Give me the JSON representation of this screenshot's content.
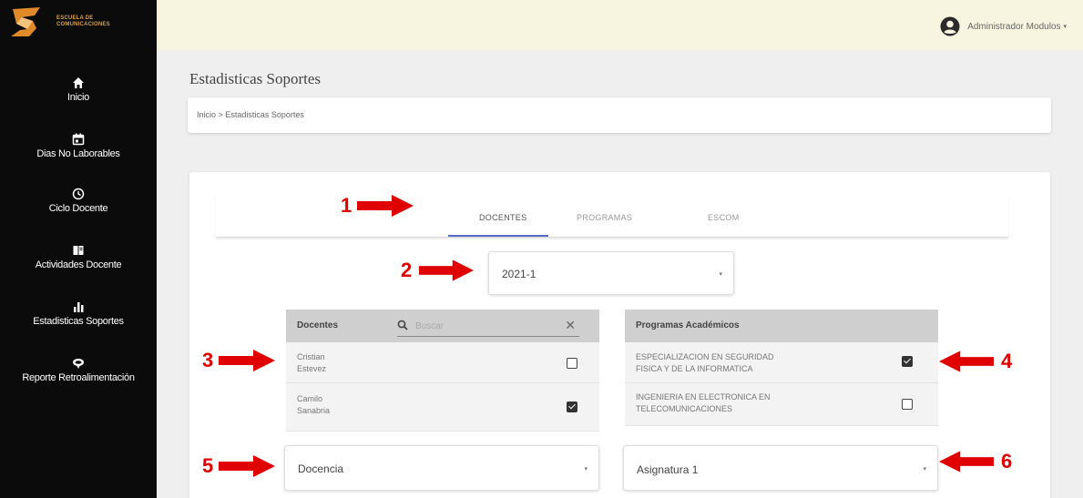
{
  "logo": {
    "name": "logo-escuela",
    "text_line1": "ESCUELA DE",
    "text_line2": "COMUNICACIONES"
  },
  "sidebar": {
    "items": [
      {
        "label": "Inicio",
        "icon": "home-icon"
      },
      {
        "label": "Dias No Laborables",
        "icon": "calendar-icon"
      },
      {
        "label": "Ciclo Docente",
        "icon": "clock-icon"
      },
      {
        "label": "Actividades Docente",
        "icon": "book-icon"
      },
      {
        "label": "Estadisticas Soportes",
        "icon": "bar-chart-icon"
      },
      {
        "label": "Reporte Retroalimentación",
        "icon": "feedback-icon"
      }
    ]
  },
  "header": {
    "user_name": "Administrador Modulos",
    "user_caret": "▾"
  },
  "page": {
    "title": "Estadisticas Soportes",
    "breadcrumb": {
      "home": "Inicio",
      "separator": ">",
      "current": "Estadisticas Soportes"
    }
  },
  "tabs": [
    {
      "label": "DOCENTES",
      "active": true
    },
    {
      "label": "PROGRAMAS",
      "active": false
    },
    {
      "label": "ESCOM",
      "active": false
    }
  ],
  "period_select": {
    "value": "2021-1",
    "caret": "▾"
  },
  "docentes_table": {
    "header": "Docentes",
    "search_placeholder": "Buscar",
    "clear_symbol": "✕",
    "rows": [
      {
        "line1": "Cristian",
        "line2": "Estevez",
        "checked": false
      },
      {
        "line1": "Camilo",
        "line2": "Sanabria",
        "checked": true
      }
    ]
  },
  "programas_table": {
    "header": "Programas Académicos",
    "rows": [
      {
        "line1": "ESPECIALIZACION EN SEGURIDAD",
        "line2": "FISICA Y DE LA INFORMATICA",
        "checked": true
      },
      {
        "line1": "INGENIERIA EN ELECTRONICA EN",
        "line2": "TELECOMUNICACIONES",
        "checked": false
      }
    ]
  },
  "activity_select": {
    "value": "Docencia",
    "caret": "▾"
  },
  "subject_select": {
    "value": "Asignatura 1",
    "caret": "▾"
  },
  "annotations": [
    "1",
    "2",
    "3",
    "4",
    "5",
    "6"
  ],
  "colors": {
    "sidebar_bg": "#0b0b0b",
    "topbar_bg": "#f7f4df",
    "main_bg": "#efefef",
    "tab_accent": "#5b6bc8",
    "annotation_red": "#e00000"
  }
}
